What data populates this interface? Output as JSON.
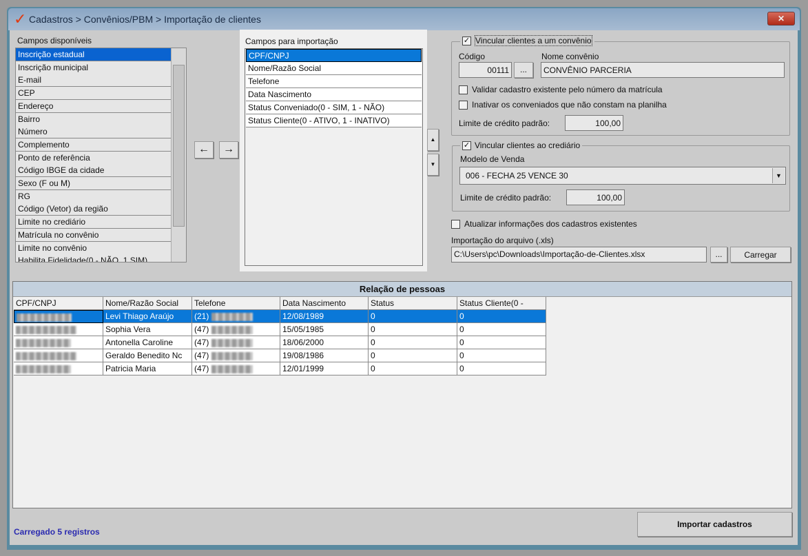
{
  "window": {
    "breadcrumb": "Cadastros > Convênios/PBM > Importação de clientes",
    "close_icon": "close-icon"
  },
  "available": {
    "label": "Campos disponíveis",
    "items": [
      "Inscrição estadual",
      "Inscrição municipal",
      "E-mail",
      "CEP",
      "Endereço",
      "Bairro",
      "Número",
      "Complemento",
      "Ponto de referência",
      "Código IBGE da cidade",
      "Sexo (F ou M)",
      "RG",
      "Código (Vetor) da região",
      "Limite no crediário",
      "Matrícula no convênio",
      "Limite no convênio",
      "Habilita Fidelidade(0 - NÃO, 1 SIM)"
    ],
    "selected": 0
  },
  "arrows": {
    "left": "←",
    "right": "→",
    "up": "▲",
    "down": "▼"
  },
  "import_fields": {
    "label": "Campos para importação",
    "items": [
      "CPF/CNPJ",
      "Nome/Razão Social",
      "Telefone",
      "Data Nascimento",
      "Status Conveniado(0 - SIM, 1 - NÃO)",
      "Status Cliente(0 - ATIVO, 1 - INATIVO)"
    ],
    "selected": 0
  },
  "convenio": {
    "checkbox_label": "Vincular clientes a um convênio",
    "checked": true,
    "codigo_label": "Código",
    "codigo": "00111",
    "browse": "...",
    "nome_label": "Nome convênio",
    "nome": "CONVÊNIO PARCERIA",
    "validar_label": "Validar cadastro existente pelo número da matrícula",
    "validar_checked": false,
    "inativar_label": "Inativar os conveniados que não constam na planilha",
    "inativar_checked": false,
    "limite_label": "Limite de crédito padrão:",
    "limite": "100,00"
  },
  "crediario": {
    "checkbox_label": "Vincular clientes ao crediário",
    "checked": true,
    "modelo_label": "Modelo de Venda",
    "modelo": "006 - FECHA 25 VENCE 30",
    "limite_label": "Limite de crédito padrão:",
    "limite": "100,00"
  },
  "atualizar": {
    "label": "Atualizar informações dos cadastros existentes",
    "checked": false
  },
  "arquivo": {
    "label": "Importação do arquivo (.xls)",
    "path": "C:\\Users\\pc\\Downloads\\Importação-de-Clientes.xlsx",
    "browse": "...",
    "load": "Carregar"
  },
  "grid": {
    "title": "Relação de pessoas",
    "columns": [
      "CPF/CNPJ",
      "Nome/Razão Social",
      "Telefone",
      "Data Nascimento",
      "Status",
      "Status Cliente(0 -"
    ],
    "rows": [
      {
        "nome": "Levi Thiago Araújo",
        "ddd": "(21)",
        "nasc": "12/08/1989",
        "status": "0",
        "status_cliente": "0"
      },
      {
        "nome": "Sophia Vera",
        "ddd": "(47)",
        "nasc": "15/05/1985",
        "status": "0",
        "status_cliente": "0"
      },
      {
        "nome": "Antonella Caroline",
        "ddd": "(47)",
        "nasc": "18/06/2000",
        "status": "0",
        "status_cliente": "0"
      },
      {
        "nome": "Geraldo Benedito Nc",
        "ddd": "(47)",
        "nasc": "19/08/1986",
        "status": "0",
        "status_cliente": "0"
      },
      {
        "nome": "Patricia Maria",
        "ddd": "(47)",
        "nasc": "12/01/1999",
        "status": "0",
        "status_cliente": "0"
      }
    ],
    "selected": 0
  },
  "footer": {
    "status": "Carregado 5 registros",
    "status_color": "#2b2bb0",
    "import_button": "Importar cadastros"
  },
  "colors": {
    "selection": "#0a78d8",
    "title_bar": "#9ab0ca"
  }
}
